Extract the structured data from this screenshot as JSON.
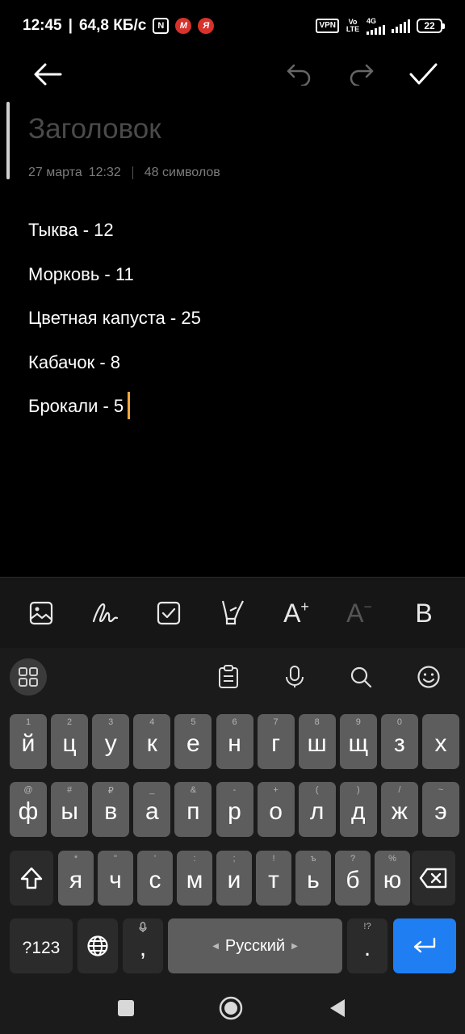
{
  "status_bar": {
    "time": "12:45",
    "separator": "|",
    "speed": "64,8 КБ/с",
    "vpn": "VPN",
    "volte": "Vo LTE",
    "network": "4G",
    "battery": "22"
  },
  "toolbar": {
    "back_icon": "arrow-left-icon",
    "undo_icon": "undo-icon",
    "redo_icon": "redo-icon",
    "done_icon": "check-icon"
  },
  "note": {
    "title_placeholder": "Заголовок",
    "date": "27 марта",
    "time": "12:32",
    "char_count": "48 символов",
    "lines": [
      "Тыква - 12",
      "Морковь - 11",
      "Цветная капуста - 25",
      "Кабачок - 8",
      "Брокали - 5"
    ]
  },
  "format_bar": {
    "image_icon": "image-icon",
    "draw_icon": "handwriting-icon",
    "checklist_icon": "checkbox-icon",
    "highlight_icon": "highlighter-icon",
    "increase_font": "A",
    "increase_sign": "+",
    "decrease_font": "A",
    "decrease_sign": "−",
    "bold": "B"
  },
  "keyboard": {
    "toolbar": [
      "grid-icon",
      "clipboard-icon",
      "microphone-icon",
      "search-icon",
      "emoji-icon"
    ],
    "row1": [
      {
        "k": "й",
        "h": "1"
      },
      {
        "k": "ц",
        "h": "2"
      },
      {
        "k": "у",
        "h": "3"
      },
      {
        "k": "к",
        "h": "4"
      },
      {
        "k": "е",
        "h": "5"
      },
      {
        "k": "н",
        "h": "6"
      },
      {
        "k": "г",
        "h": "7"
      },
      {
        "k": "ш",
        "h": "8"
      },
      {
        "k": "щ",
        "h": "9"
      },
      {
        "k": "з",
        "h": "0"
      },
      {
        "k": "х",
        "h": ""
      }
    ],
    "row2": [
      {
        "k": "ф",
        "h": "@"
      },
      {
        "k": "ы",
        "h": "#"
      },
      {
        "k": "в",
        "h": "₽"
      },
      {
        "k": "а",
        "h": "_"
      },
      {
        "k": "п",
        "h": "&"
      },
      {
        "k": "р",
        "h": "-"
      },
      {
        "k": "о",
        "h": "+"
      },
      {
        "k": "л",
        "h": "("
      },
      {
        "k": "д",
        "h": ")"
      },
      {
        "k": "ж",
        "h": "/"
      },
      {
        "k": "э",
        "h": "~"
      }
    ],
    "row3": [
      {
        "k": "я",
        "h": "*"
      },
      {
        "k": "ч",
        "h": "\""
      },
      {
        "k": "с",
        "h": "'"
      },
      {
        "k": "м",
        "h": ":"
      },
      {
        "k": "и",
        "h": ";"
      },
      {
        "k": "т",
        "h": "!"
      },
      {
        "k": "ь",
        "h": "ъ"
      },
      {
        "k": "б",
        "h": "?"
      },
      {
        "k": "ю",
        "h": "%"
      }
    ],
    "shift_icon": "shift-icon",
    "backspace_icon": "backspace-icon",
    "num_switch": "?123",
    "globe_icon": "globe-icon",
    "comma": ",",
    "space_label": "Русский",
    "period": ".",
    "period_hint": "!?",
    "enter_icon": "enter-icon"
  },
  "nav_bar": [
    "recents-icon",
    "home-icon",
    "back-icon"
  ],
  "colors": {
    "background": "#000000",
    "caret": "#f1a83d",
    "key": "#5d5d5d",
    "enter_key": "#1e7ef2"
  }
}
